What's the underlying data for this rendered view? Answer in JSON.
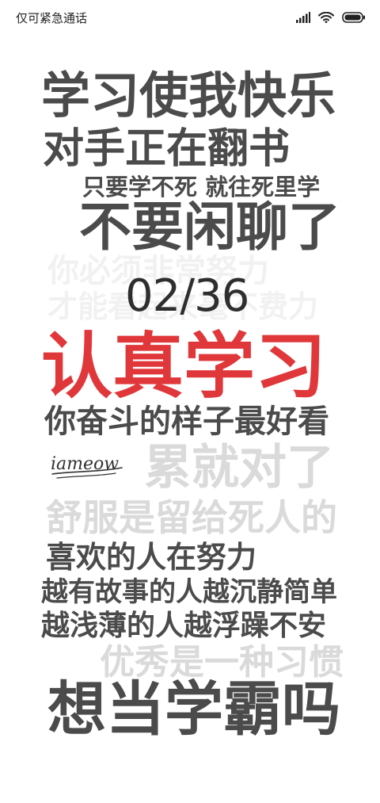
{
  "status_bar": {
    "carrier_text": "仅可紧急通话",
    "icons": [
      "signal-icon",
      "wifi-icon",
      "battery-icon"
    ]
  },
  "lockscreen": {
    "lines": [
      "学习使我快乐",
      "对手正在翻书",
      "只要学不死 就往死里学",
      "不要闲聊了",
      "你必须非常努力",
      "才能看起来毫不费力",
      "认真学习",
      "你奋斗的样子最好看",
      "累就对了",
      "舒服是留给死人的",
      "喜欢的人在努力",
      "越有故事的人越沉静简单",
      "越浅薄的人越浮躁不安",
      "优秀是一种习惯",
      "想当学霸吗"
    ],
    "date_text": "02/36",
    "logo_text": "iameow"
  },
  "colors": {
    "dark_text": "#4b4b4b",
    "accent_red": "#e0373a",
    "light_text": "#dadada",
    "faint_text": "#f1f1f1"
  }
}
